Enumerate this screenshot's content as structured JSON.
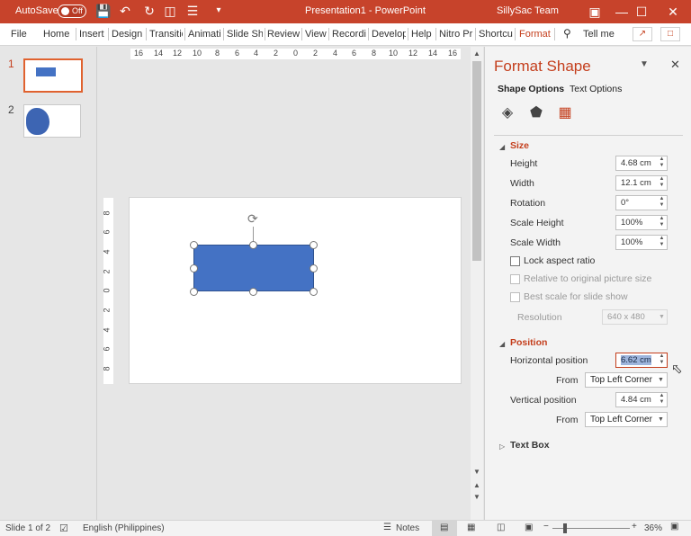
{
  "colors": {
    "accent": "#c43e1c",
    "titlebar": "#c7432b",
    "shape_fill": "#4472c4"
  },
  "titlebar": {
    "autosave_label": "AutoSave",
    "autosave_state": "Off",
    "document_title": "Presentation1  -  PowerPoint",
    "user": "SillySac Team",
    "icons": [
      "save-icon",
      "undo-icon",
      "redo-icon",
      "present-icon",
      "bullets-icon",
      "customize-qat-icon"
    ]
  },
  "ribbon": {
    "tabs": [
      "File",
      "Home",
      "Insert",
      "Design",
      "Transitio",
      "Animati",
      "Slide Sh",
      "Review",
      "View",
      "Recordi",
      "Develop",
      "Help",
      "Nitro Pr",
      "Shortcu",
      "Format"
    ],
    "active_tab": "Format",
    "tell_me": "Tell me"
  },
  "thumbnails": {
    "items": [
      {
        "number": "1"
      },
      {
        "number": "2"
      }
    ]
  },
  "rulers": {
    "horizontal": [
      "16",
      "14",
      "12",
      "10",
      "8",
      "6",
      "4",
      "2",
      "0",
      "2",
      "4",
      "6",
      "8",
      "10",
      "12",
      "14",
      "16"
    ],
    "vertical": [
      "8",
      "6",
      "4",
      "2",
      "0",
      "2",
      "4",
      "6",
      "8"
    ]
  },
  "pane": {
    "title": "Format Shape",
    "tabs": [
      "Shape Options",
      "Text Options"
    ],
    "icons": [
      "fill-line-icon",
      "effects-icon",
      "size-properties-icon"
    ],
    "size": {
      "header": "Size",
      "height_label": "Height",
      "height_value": "4.68 cm",
      "width_label": "Width",
      "width_value": "12.1 cm",
      "rotation_label": "Rotation",
      "rotation_value": "0°",
      "scale_height_label": "Scale Height",
      "scale_height_value": "100%",
      "scale_width_label": "Scale Width",
      "scale_width_value": "100%",
      "lock_aspect_label": "Lock aspect ratio",
      "relative_label": "Relative to original picture size",
      "best_scale_label": "Best scale for slide show",
      "resolution_label": "Resolution",
      "resolution_value": "640 x 480"
    },
    "position": {
      "header": "Position",
      "horizontal_label": "Horizontal position",
      "horizontal_value": "6.62 cm",
      "from_label": "From",
      "horizontal_from": "Top Left Corner",
      "vertical_label": "Vertical position",
      "vertical_value": "4.84 cm",
      "vertical_from": "Top Left Corner"
    },
    "text_box": {
      "header": "Text Box"
    }
  },
  "status": {
    "slide_info": "Slide 1 of 2",
    "language": "English (Philippines)",
    "notes": "Notes",
    "zoom": "36%"
  }
}
